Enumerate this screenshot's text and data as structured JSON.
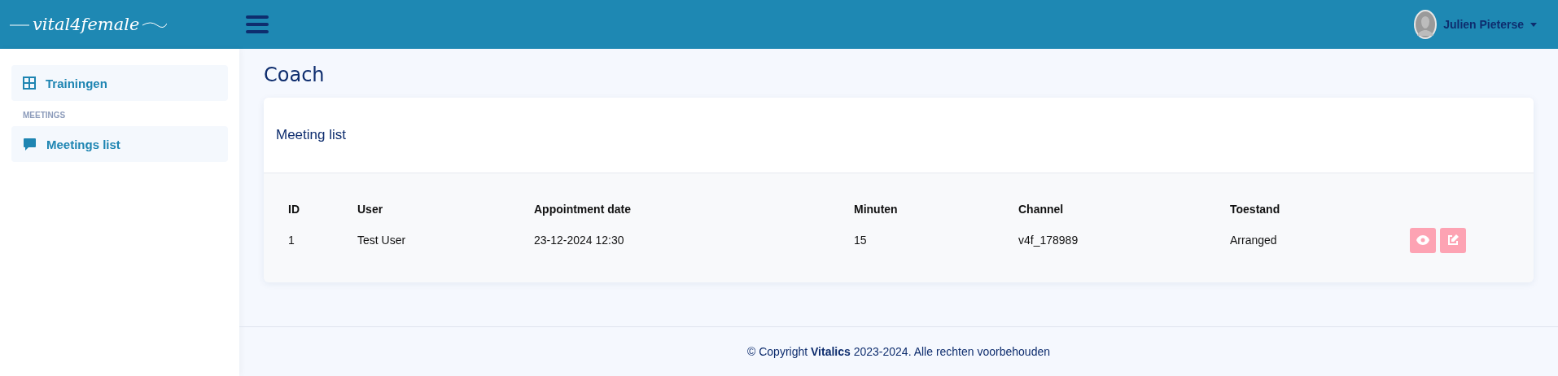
{
  "header": {
    "logo": "vital4female",
    "user": {
      "name": "Julien Pieterse"
    }
  },
  "sidebar": {
    "sections": [
      {
        "items": [
          {
            "label": "Trainingen",
            "kind": "grid"
          }
        ]
      },
      {
        "heading": "MEETINGS",
        "items": [
          {
            "label": "Meetings list",
            "kind": "chat"
          }
        ]
      }
    ]
  },
  "page": {
    "title": "Coach"
  },
  "card": {
    "title": "Meeting list",
    "table": {
      "columns": [
        "ID",
        "User",
        "Appointment date",
        "Minuten",
        "Channel",
        "Toestand"
      ],
      "rows": [
        {
          "cells": [
            "1",
            "Test User",
            "23-12-2024 12:30",
            "15",
            "v4f_178989",
            "Arranged"
          ],
          "actions": [
            {
              "kind": "view"
            },
            {
              "kind": "edit"
            }
          ]
        }
      ]
    }
  },
  "footer": {
    "text": "© Copyright **Vitalics** 2023-2024. Alle rechten voorbehouden"
  }
}
